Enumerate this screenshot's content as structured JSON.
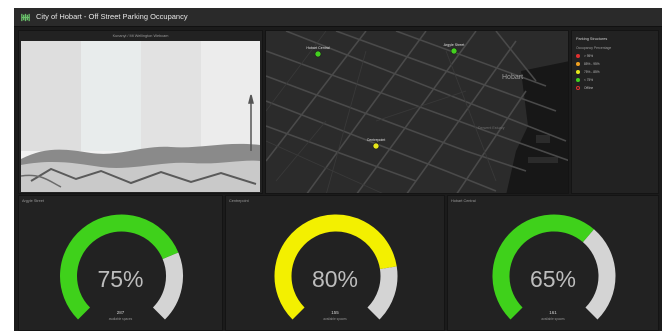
{
  "header": {
    "title": "City of Hobart - Off Street Parking Occupancy"
  },
  "camera": {
    "caption": "Kunanyi / Mt Wellington Webcam"
  },
  "map": {
    "city_label": "Hobart",
    "water_label": "Derwent Estuary",
    "markers": [
      {
        "label": "Hobart Central",
        "color": "#43d01f"
      },
      {
        "label": "Argyle Street",
        "color": "#43d01f"
      },
      {
        "label": "Centrepoint",
        "color": "#e6e61a"
      }
    ]
  },
  "legend": {
    "title": "Parking Structures",
    "subtitle": "Occupancy Percentage",
    "items": [
      {
        "label": "> 95%",
        "color": "#e03030",
        "fill": true
      },
      {
        "label": "85% - 95%",
        "color": "#f0a020",
        "fill": true
      },
      {
        "label": "75% - 85%",
        "color": "#e6e61a",
        "fill": true
      },
      {
        "label": "< 75%",
        "color": "#43d01f",
        "fill": true
      },
      {
        "label": "Offline",
        "color": "#e03030",
        "fill": false
      }
    ]
  },
  "gauges": [
    {
      "title": "Argyle Street",
      "percent_label": "75%",
      "fraction": 0.75,
      "count": "287",
      "sub": "available spaces",
      "color": "#3fd11b"
    },
    {
      "title": "Centrepoint",
      "percent_label": "80%",
      "fraction": 0.8,
      "count": "155",
      "sub": "available spaces",
      "color": "#f3f000"
    },
    {
      "title": "Hobart Central",
      "percent_label": "65%",
      "fraction": 0.65,
      "count": "161",
      "sub": "available spaces",
      "color": "#3fd11b"
    }
  ],
  "colors": {
    "gauge_track": "#d4d4d4",
    "background": "#1b1b1b"
  }
}
